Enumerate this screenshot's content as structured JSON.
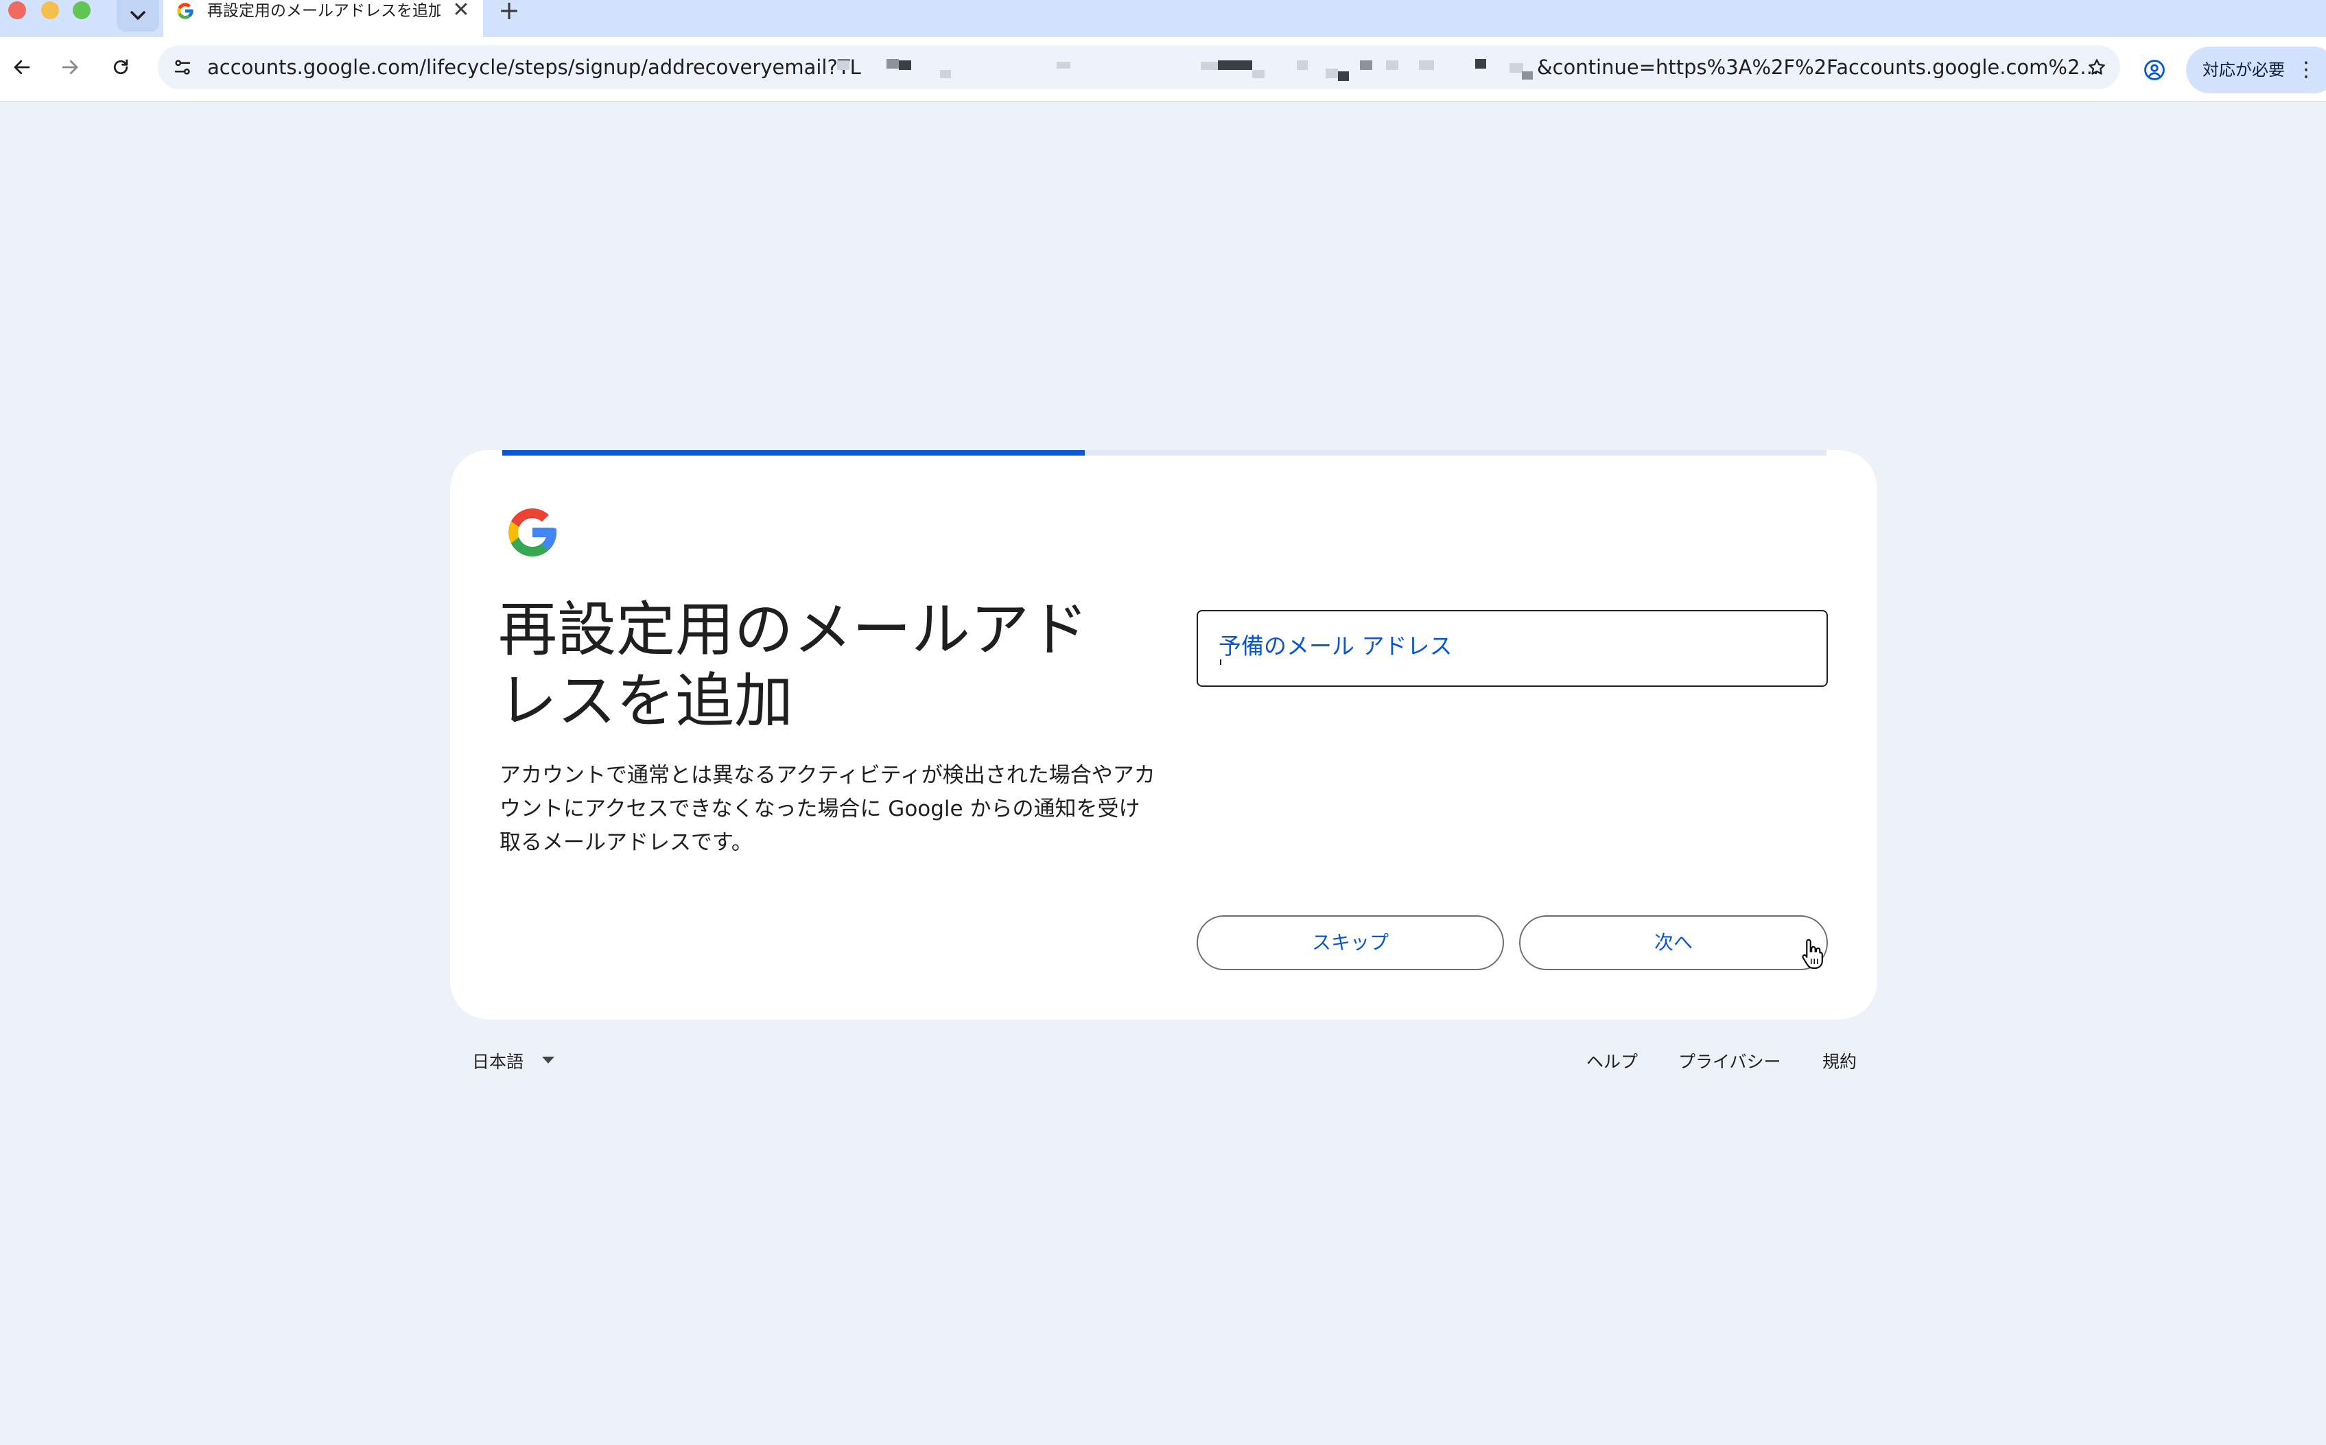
{
  "browser": {
    "tab_title": "再設定用のメールアドレスを追加",
    "tab_close": "✕",
    "new_tab": "+",
    "url_prefix": "accounts.google.com/lifecycle/steps/signup/addrecoveryemail?TL",
    "url_suffix": "&continue=https%3A%2F%2Faccounts.google.com%2...",
    "action_chip": "対応が必要",
    "icons": [
      "back-icon",
      "forward-icon",
      "reload-icon",
      "site-info-icon",
      "bookmark-star-icon",
      "profile-icon",
      "more-icon"
    ]
  },
  "signup": {
    "progress": 0.44,
    "headline": "再設定用のメールアドレスを追加",
    "description": "アカウントで通常とは異なるアクティビティが検出された場合やアカウントにアクセスできなくなった場合に Google からの通知を受け取るメールアドレスです。",
    "email_field_label": "予備のメール アドレス",
    "skip_label": "スキップ",
    "next_label": "次へ"
  },
  "footer": {
    "language": "日本語",
    "help": "ヘルプ",
    "privacy": "プライバシー",
    "terms": "規約"
  },
  "colors": {
    "accent": "#0b57d0",
    "page_background": "#edf1f8",
    "tab_strip": "#d3e3fd"
  }
}
